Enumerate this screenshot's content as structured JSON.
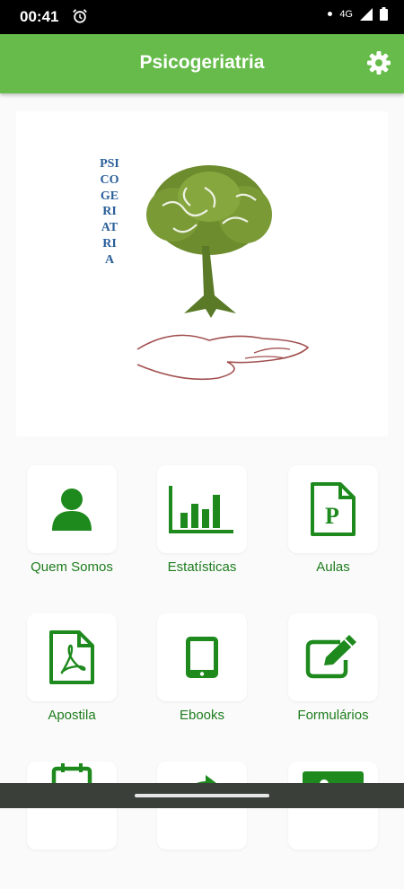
{
  "status_bar": {
    "time": "00:41",
    "network": "4G"
  },
  "app_bar": {
    "title": "Psicogeriatria"
  },
  "banner": {
    "logo_text": "PSICOGERIATRIA"
  },
  "menu": [
    {
      "label": "Quem Somos",
      "icon": "person-icon"
    },
    {
      "label": "Estatísticas",
      "icon": "bar-chart-icon"
    },
    {
      "label": "Aulas",
      "icon": "powerpoint-file-icon"
    },
    {
      "label": "Apostila",
      "icon": "pdf-file-icon"
    },
    {
      "label": "Ebooks",
      "icon": "tablet-icon"
    },
    {
      "label": "Formulários",
      "icon": "edit-form-icon"
    }
  ],
  "colors": {
    "accent": "#66bb4a",
    "icon_green": "#1e8a1e",
    "label_green": "#1e7d1e"
  }
}
